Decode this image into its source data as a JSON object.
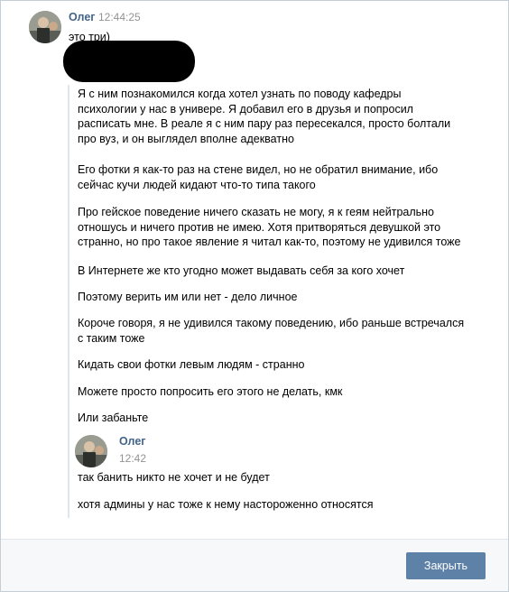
{
  "message1": {
    "author": "Олег",
    "time": "12:44:25",
    "first_line": "это три)"
  },
  "quoted_paragraphs": [
    [
      "Я с ним познакомился когда хотел узнать по поводу кафедры",
      "психологии у нас в универе. Я добавил его в друзья и попросил",
      "расписать мне. В реале я с ним пару раз пересекался, просто болтали",
      "про вуз, и он выглядел вполне адекватно"
    ],
    [
      "Его фотки я как-то раз на стене видел, но не обратил внимание, ибо",
      "сейчас кучи людей кидают что-то типа такого"
    ],
    [
      "Про гейское поведение ничего сказать не могу, я к геям нейтрально",
      "отношусь и ничего против не имею. Хотя притворяться девушкой это",
      "странно, но про такое явление я читал как-то, поэтому не удивился тоже"
    ],
    [
      "В Интернете же кто угодно может выдавать себя за кого хочет"
    ],
    [
      "Поэтому верить им или нет - дело личное"
    ],
    [
      "Короче говоря, я не удивился такому поведению, ибо раньше встречался",
      "с таким тоже"
    ],
    [
      "Кидать свои фотки левым людям - странно"
    ],
    [
      "Можете просто попросить его этого не делать, кмк"
    ],
    [
      "Или забаньте"
    ]
  ],
  "message2": {
    "author": "Олег",
    "time": "12:42",
    "lines": [
      "так банить никто не хочет и не будет",
      "хотя админы у нас тоже к нему настороженно относятся"
    ]
  },
  "footer": {
    "close_label": "Закрыть"
  },
  "colors": {
    "author": "#42648b",
    "time": "#939393",
    "button": "#5e81a8",
    "quote_bar": "#dfe6ed"
  }
}
